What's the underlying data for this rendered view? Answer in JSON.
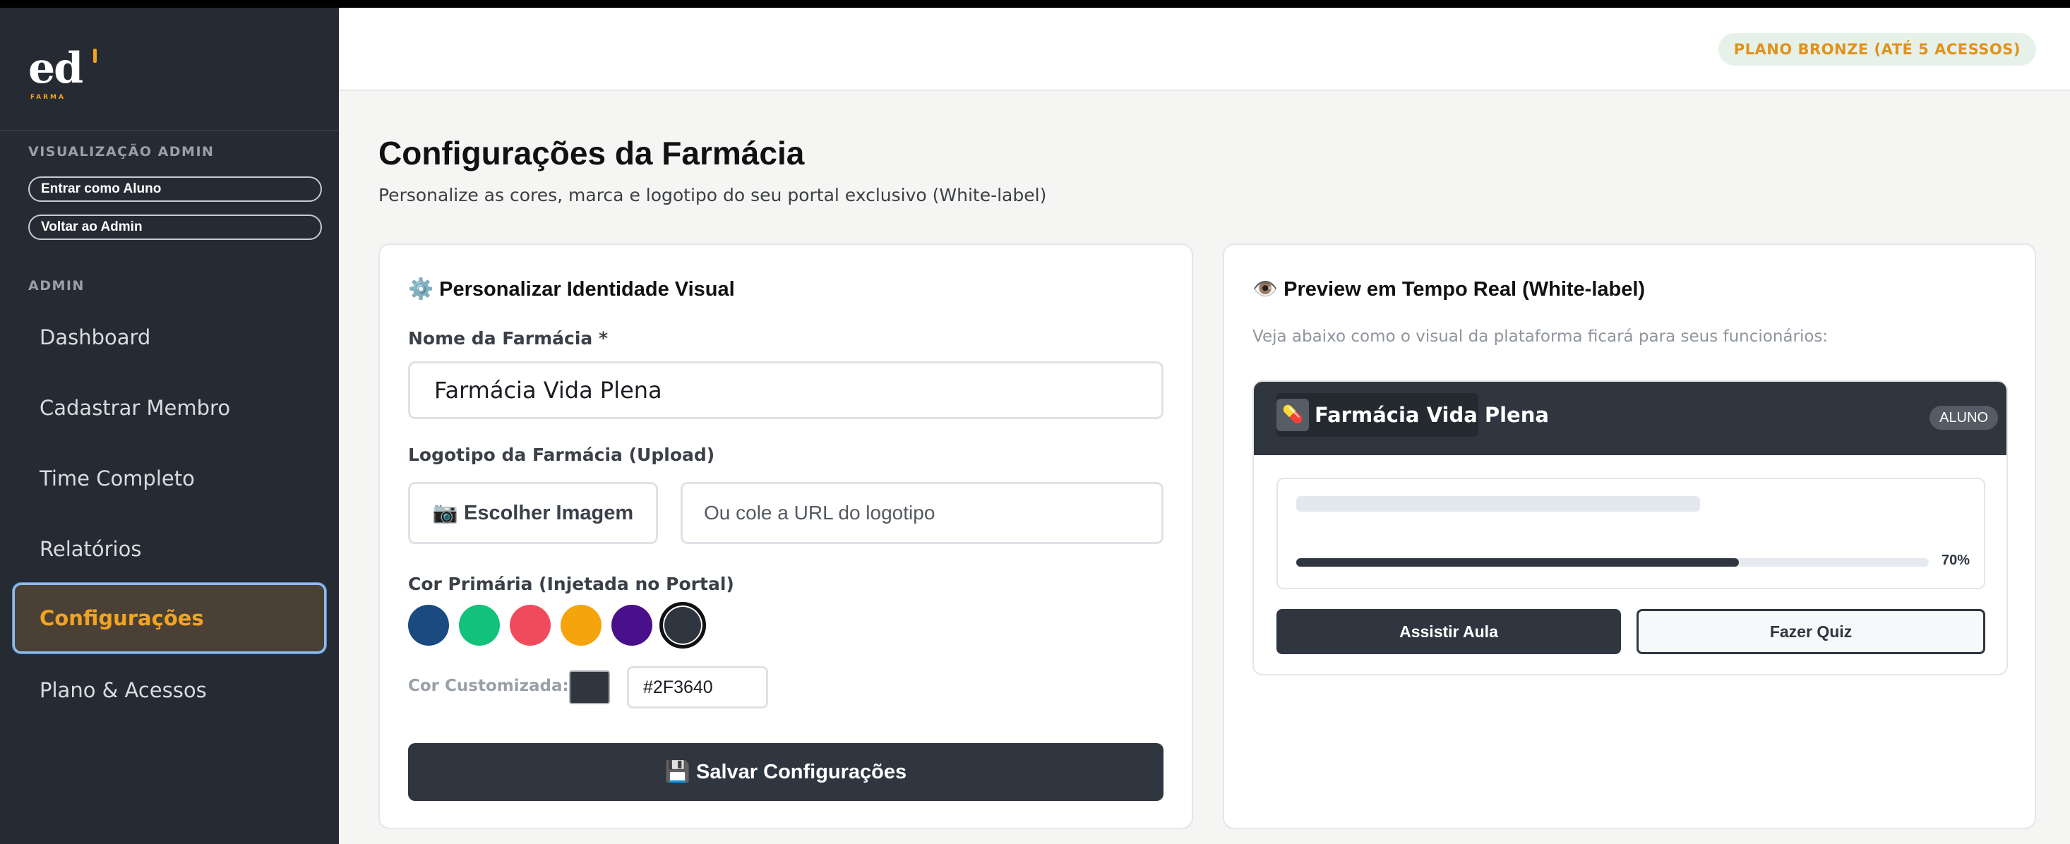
{
  "brand": {
    "logo_text": "ed",
    "logo_sub": "FARMA"
  },
  "sidebar": {
    "admin_view_label": "VISUALIZAÇÃO ADMIN",
    "enter_student_label": "Entrar como Aluno",
    "back_admin_label": "Voltar ao Admin",
    "admin_section_label": "ADMIN",
    "items": [
      {
        "label": "Dashboard",
        "active": false
      },
      {
        "label": "Cadastrar Membro",
        "active": false
      },
      {
        "label": "Time Completo",
        "active": false
      },
      {
        "label": "Relatórios",
        "active": false
      },
      {
        "label": "Configurações",
        "active": true
      },
      {
        "label": "Plano & Acessos",
        "active": false
      }
    ]
  },
  "header": {
    "plan_badge": "PLANO BRONZE (ATÉ 5 ACESSOS)"
  },
  "page": {
    "title": "Configurações da Farmácia",
    "subtitle": "Personalize as cores, marca e logotipo do seu portal exclusivo (White-label)"
  },
  "form": {
    "card_title": "⚙️ Personalizar Identidade Visual",
    "name_label": "Nome da Farmácia *",
    "name_value": "Farmácia Vida Plena",
    "logo_label": "Logotipo da Farmácia (Upload)",
    "choose_image_label": "📷 Escolher Imagem",
    "logo_url_placeholder": "Ou cole a URL do logotipo",
    "primary_color_label": "Cor Primária (Injetada no Portal)",
    "swatches": [
      "#1a4a80",
      "#12c17a",
      "#f04b5c",
      "#f6a40d",
      "#4a0f8a",
      "#2f3640"
    ],
    "selected_swatch": "#2f3640",
    "custom_color_label": "Cor Customizada:",
    "custom_color_value": "#2F3640",
    "save_label": "💾 Salvar Configurações"
  },
  "preview": {
    "card_title": "👁️ Preview em Tempo Real (White-label)",
    "subtitle": "Veja abaixo como o visual da plataforma ficará para seus funcionários:",
    "pharmacy_name": "Farmácia Vida Plena",
    "icon": "💊",
    "role_badge": "ALUNO",
    "progress": 0.7,
    "progress_label": "70%",
    "watch_label": "Assistir Aula",
    "quiz_label": "Fazer Quiz"
  },
  "colors": {
    "primary": "#2f3640",
    "accent": "#f2a421",
    "sidebar_bg": "#262b33"
  }
}
